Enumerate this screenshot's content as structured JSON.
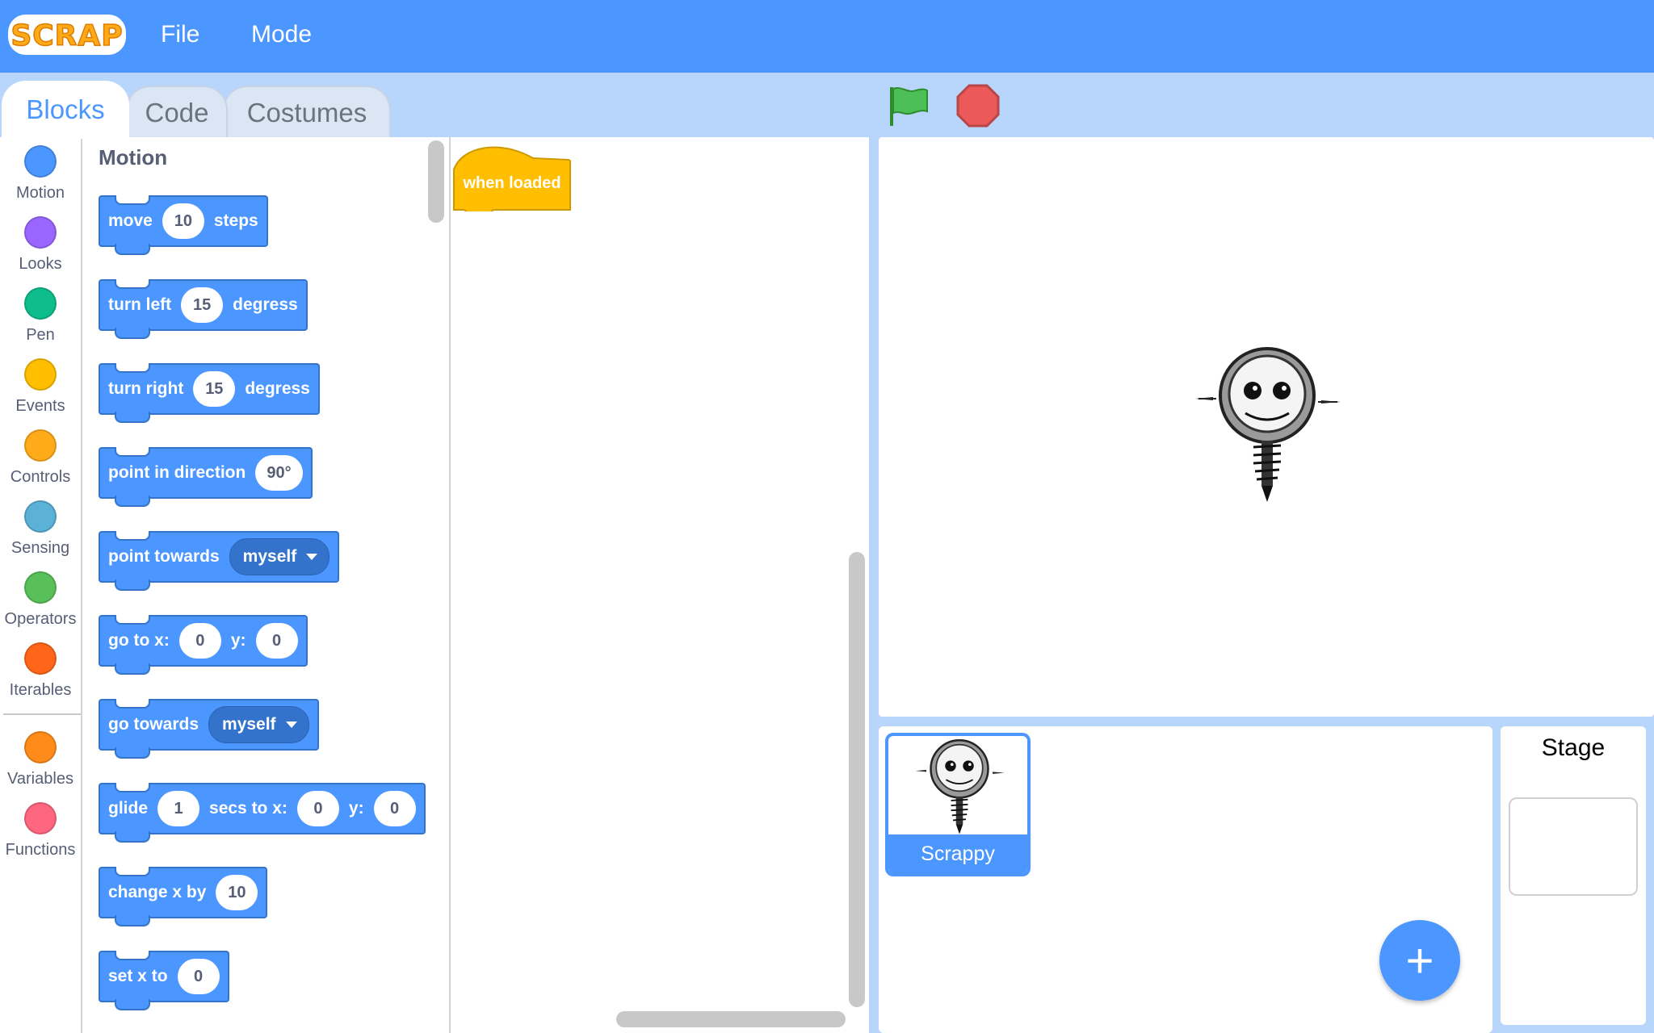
{
  "app": {
    "logo_text": "SCRAP"
  },
  "menu": {
    "file": "File",
    "mode": "Mode"
  },
  "tabs": [
    {
      "label": "Blocks",
      "active": true
    },
    {
      "label": "Code",
      "active": false
    },
    {
      "label": "Costumes",
      "active": false
    }
  ],
  "run_controls": {
    "start_icon": "green-flag-icon",
    "stop_icon": "stop-sign-icon"
  },
  "categories": [
    {
      "label": "Motion",
      "color": "#4c97ff"
    },
    {
      "label": "Looks",
      "color": "#9966ff"
    },
    {
      "label": "Pen",
      "color": "#0fbd8c"
    },
    {
      "label": "Events",
      "color": "#ffbf00"
    },
    {
      "label": "Controls",
      "color": "#ffab19"
    },
    {
      "label": "Sensing",
      "color": "#5cb1d6"
    },
    {
      "label": "Operators",
      "color": "#59c059"
    },
    {
      "label": "Iterables",
      "color": "#ff661a"
    },
    {
      "label": "Variables",
      "color": "#ff8c1a"
    },
    {
      "label": "Functions",
      "color": "#ff6680"
    }
  ],
  "palette": {
    "title": "Motion",
    "blocks": {
      "move": {
        "t1": "move",
        "v1": "10",
        "t2": "steps"
      },
      "turn_left": {
        "t1": "turn left",
        "v1": "15",
        "t2": "degress"
      },
      "turn_right": {
        "t1": "turn right",
        "v1": "15",
        "t2": "degress"
      },
      "point_dir": {
        "t1": "point in direction",
        "v1": "90°"
      },
      "point_towards": {
        "t1": "point towards",
        "d1": "myself"
      },
      "go_to": {
        "t1": "go to x:",
        "v1": "0",
        "t2": "y:",
        "v2": "0"
      },
      "go_towards": {
        "t1": "go towards",
        "d1": "myself"
      },
      "glide": {
        "t1": "glide",
        "v1": "1",
        "t2": "secs to x:",
        "v2": "0",
        "t3": "y:",
        "v3": "0"
      },
      "change_x": {
        "t1": "change x by",
        "v1": "10"
      },
      "set_x": {
        "t1": "set x to",
        "v1": "0"
      }
    }
  },
  "code": {
    "hat_block": "when loaded"
  },
  "sprites": [
    {
      "name": "Scrappy",
      "selected": true
    }
  ],
  "add_sprite": "+",
  "stage_panel": {
    "label": "Stage"
  },
  "colors": {
    "topbar": "#4c97ff",
    "background": "#b8d5fb",
    "motion_block": "#4c97ff",
    "event_block": "#ffbf00"
  }
}
